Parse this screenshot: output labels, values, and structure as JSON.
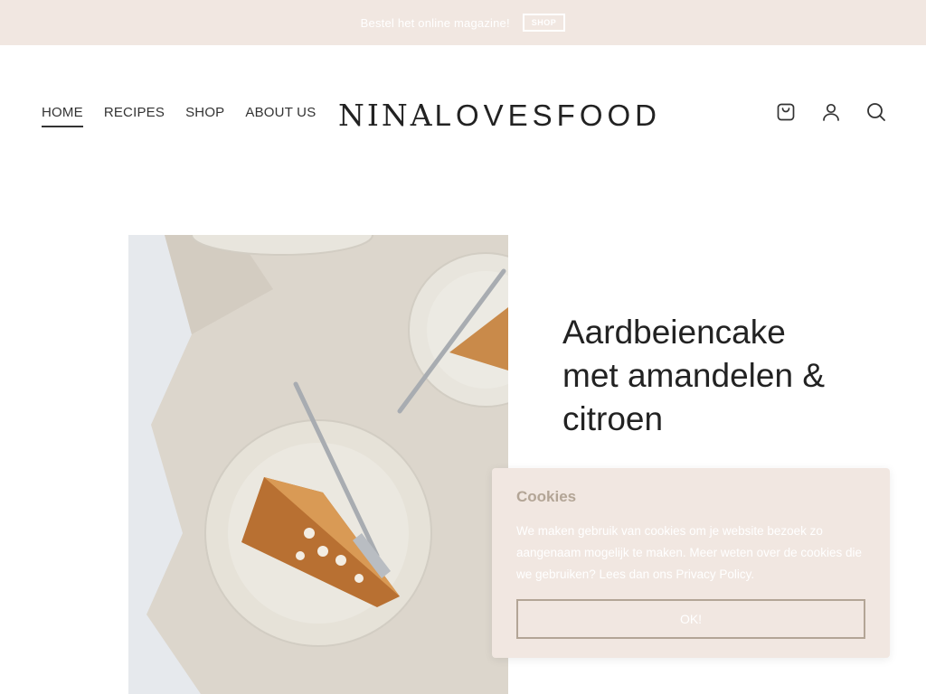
{
  "topbar": {
    "text": "Bestel het online magazine!",
    "button_label": "SHOP"
  },
  "nav": {
    "items": [
      {
        "label": "HOME",
        "active": true
      },
      {
        "label": "RECIPES",
        "active": false
      },
      {
        "label": "SHOP",
        "active": false
      },
      {
        "label": "ABOUT US",
        "active": false
      }
    ]
  },
  "logo": {
    "part1": "NINA",
    "part2": "LOVESFOOD"
  },
  "header_icons": [
    "cart-icon",
    "user-icon",
    "search-icon"
  ],
  "hero": {
    "title": "Aardbeiencake met amandelen & citroen"
  },
  "cookie": {
    "title": "Cookies",
    "text": "We maken gebruik van cookies om je website bezoek zo aangenaam mogelijk te maken. Meer weten over de cookies die we gebruiken? Lees dan ons ",
    "link_text": "Privacy Policy",
    "text_end": ".",
    "button_label": "OK!"
  },
  "colors": {
    "topbar_bg": "#f1e7e1",
    "cookie_bg": "#f1e7e1",
    "cookie_accent": "#b3a596",
    "text": "#222222"
  }
}
